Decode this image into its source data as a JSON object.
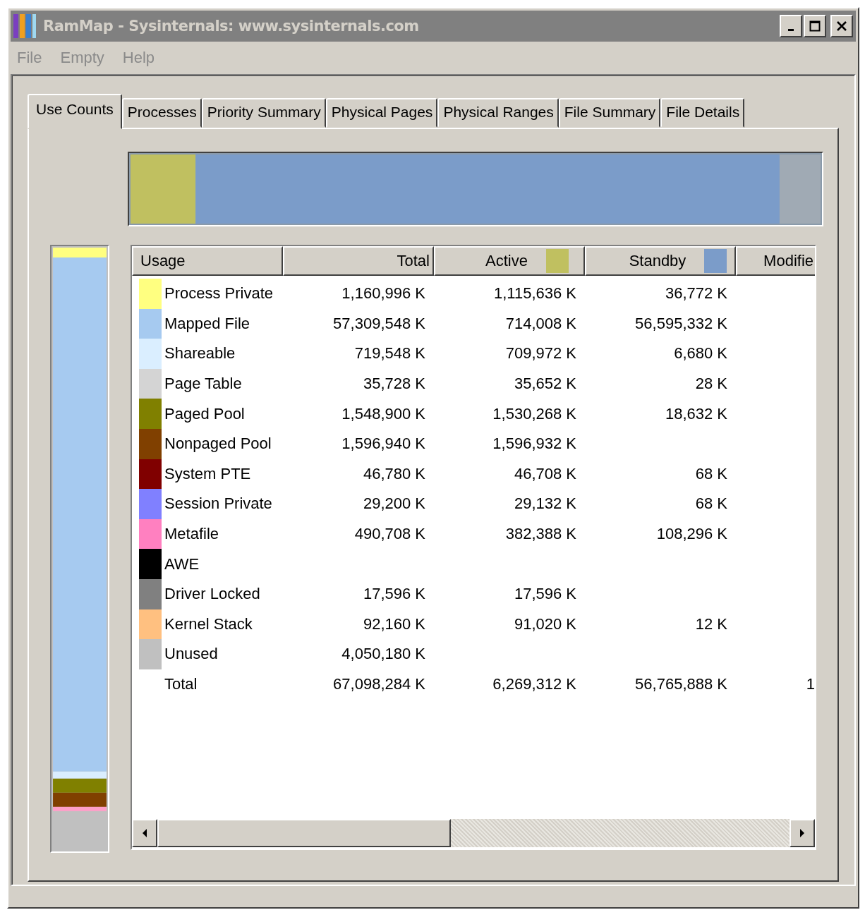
{
  "window": {
    "title": "RamMap - Sysinternals: www.sysinternals.com"
  },
  "menu": [
    "File",
    "Empty",
    "Help"
  ],
  "tabs": [
    {
      "label": "Use Counts",
      "selected": true
    },
    {
      "label": "Processes",
      "selected": false
    },
    {
      "label": "Priority Summary",
      "selected": false
    },
    {
      "label": "Physical Pages",
      "selected": false
    },
    {
      "label": "Physical Ranges",
      "selected": false
    },
    {
      "label": "File Summary",
      "selected": false
    },
    {
      "label": "File Details",
      "selected": false
    }
  ],
  "table": {
    "columns": [
      {
        "label": "Usage"
      },
      {
        "label": "Total"
      },
      {
        "label": "Active",
        "color": "#c0c060"
      },
      {
        "label": "Standby",
        "color": "#7b9cc9"
      },
      {
        "label": "Modifie"
      }
    ],
    "rows": [
      {
        "usage": "Process Private",
        "color": "#ffff80",
        "total": "1,160,996 K",
        "active": "1,115,636 K",
        "standby": "36,772 K"
      },
      {
        "usage": "Mapped File",
        "color": "#a6caf0",
        "total": "57,309,548 K",
        "active": "714,008 K",
        "standby": "56,595,332 K"
      },
      {
        "usage": "Shareable",
        "color": "#daeeff",
        "total": "719,548 K",
        "active": "709,972 K",
        "standby": "6,680 K"
      },
      {
        "usage": "Page Table",
        "color": "#d4d4d4",
        "total": "35,728 K",
        "active": "35,652 K",
        "standby": "28 K"
      },
      {
        "usage": "Paged Pool",
        "color": "#808000",
        "total": "1,548,900 K",
        "active": "1,530,268 K",
        "standby": "18,632 K"
      },
      {
        "usage": "Nonpaged Pool",
        "color": "#804000",
        "total": "1,596,940 K",
        "active": "1,596,932 K"
      },
      {
        "usage": "System PTE",
        "color": "#800000",
        "total": "46,780 K",
        "active": "46,708 K",
        "standby": "68 K"
      },
      {
        "usage": "Session Private",
        "color": "#8080ff",
        "total": "29,200 K",
        "active": "29,132 K",
        "standby": "68 K"
      },
      {
        "usage": "Metafile",
        "color": "#ff80c0",
        "total": "490,708 K",
        "active": "382,388 K",
        "standby": "108,296 K"
      },
      {
        "usage": "AWE",
        "color": "#000000"
      },
      {
        "usage": "Driver Locked",
        "color": "#808080",
        "total": "17,596 K",
        "active": "17,596 K"
      },
      {
        "usage": "Kernel Stack",
        "color": "#ffc080",
        "total": "92,160 K",
        "active": "91,020 K",
        "standby": "12 K"
      },
      {
        "usage": "Unused",
        "color": "#c0c0c0",
        "total": "4,050,180 K"
      },
      {
        "usage": "Total",
        "total": "67,098,284 K",
        "active": "6,269,312 K",
        "standby": "56,765,888 K",
        "modified": "1"
      }
    ]
  }
}
